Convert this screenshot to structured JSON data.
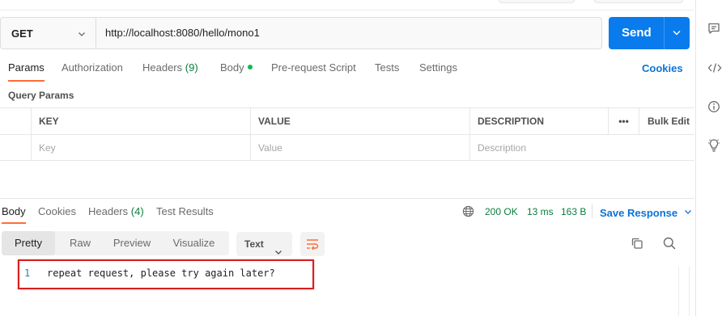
{
  "request": {
    "method": "GET",
    "url": "http://localhost:8080/hello/mono1",
    "send_label": "Send"
  },
  "request_tabs": [
    {
      "label": "Params",
      "active": true
    },
    {
      "label": "Authorization"
    },
    {
      "label": "Headers",
      "count": "(9)"
    },
    {
      "label": "Body",
      "has_dot": true
    },
    {
      "label": "Pre-request Script"
    },
    {
      "label": "Tests"
    },
    {
      "label": "Settings"
    }
  ],
  "cookies_label": "Cookies",
  "query_params": {
    "title": "Query Params",
    "columns": [
      "KEY",
      "VALUE",
      "DESCRIPTION"
    ],
    "more_label": "•••",
    "bulk_edit_label": "Bulk Edit",
    "placeholders": {
      "key": "Key",
      "value": "Value",
      "description": "Description"
    }
  },
  "response_tabs": [
    {
      "label": "Body",
      "active": true
    },
    {
      "label": "Cookies"
    },
    {
      "label": "Headers",
      "count": "(4)"
    },
    {
      "label": "Test Results"
    }
  ],
  "response_status": {
    "status": "200 OK",
    "time": "13 ms",
    "size": "163 B",
    "save_label": "Save Response"
  },
  "view_modes": [
    {
      "label": "Pretty",
      "active": true
    },
    {
      "label": "Raw"
    },
    {
      "label": "Preview"
    },
    {
      "label": "Visualize"
    }
  ],
  "format": "Text",
  "response_body": {
    "line_number": "1",
    "text": "repeat request, please try again later?"
  },
  "colors": {
    "accent": "#ff6c37",
    "send_button": "#097bed",
    "link": "#0b73d8",
    "status_ok": "#0a7d3c",
    "highlight_box": "#d81f1f"
  },
  "icons": {
    "rail": [
      "comment-icon",
      "code-icon",
      "info-icon",
      "lightbulb-icon"
    ],
    "toolbar": [
      "wrap-lines-icon",
      "copy-icon",
      "search-icon",
      "globe-icon"
    ]
  }
}
